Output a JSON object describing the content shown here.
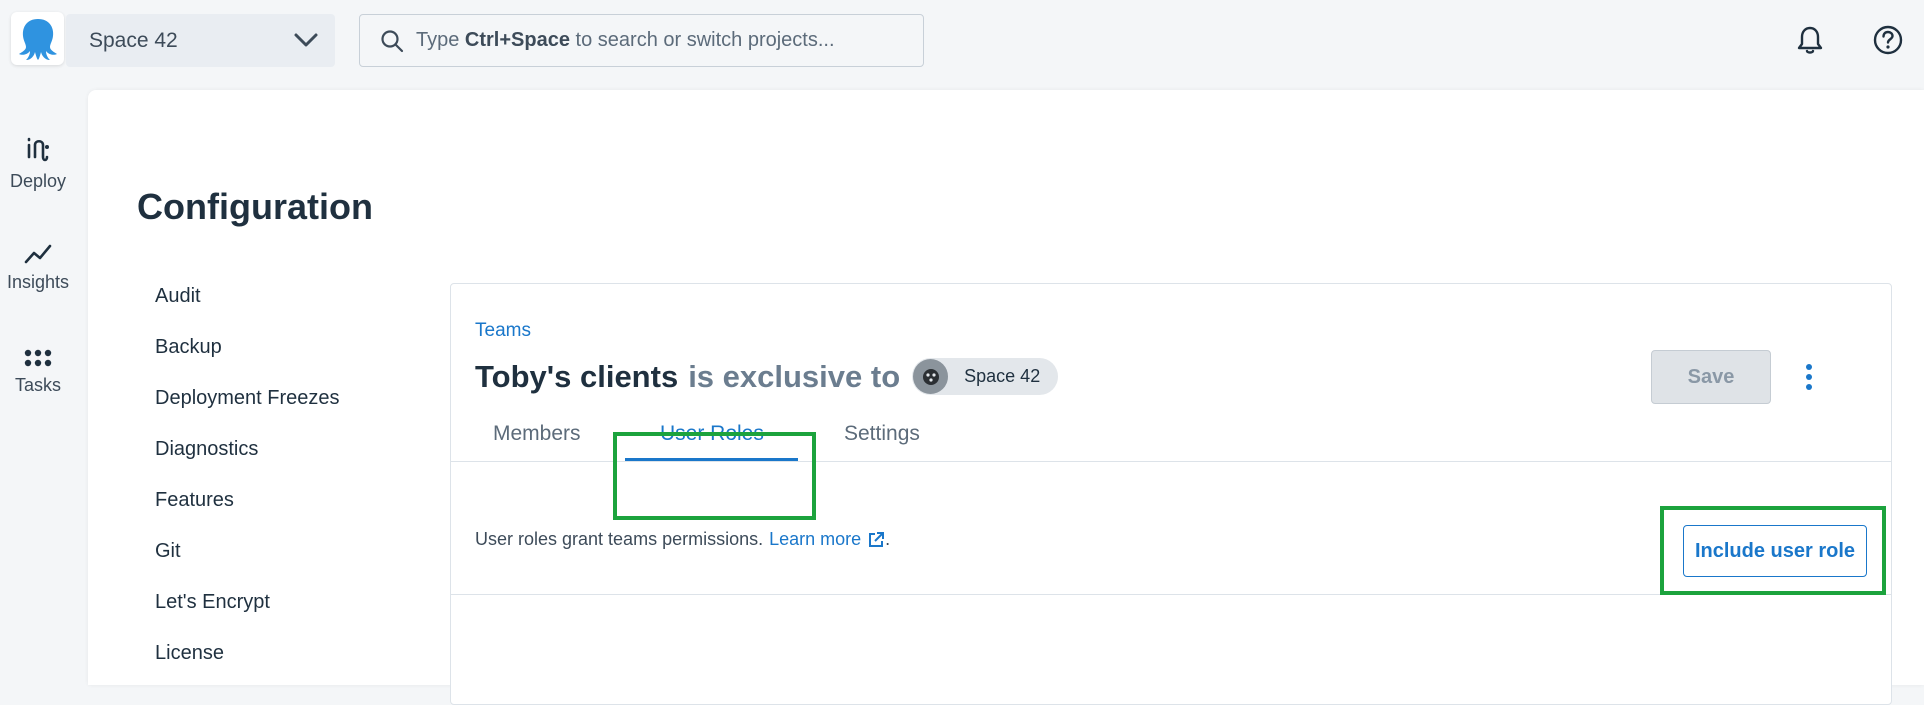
{
  "header": {
    "space_name": "Space 42",
    "search": {
      "prefix": "Type",
      "shortcut": "Ctrl+Space",
      "suffix": "to search or switch projects..."
    }
  },
  "left_nav": [
    {
      "label": "Deploy",
      "icon": "deploy-icon"
    },
    {
      "label": "Insights",
      "icon": "insights-icon"
    },
    {
      "label": "Tasks",
      "icon": "tasks-icon"
    }
  ],
  "page": {
    "title": "Configuration",
    "config_menu": [
      "Audit",
      "Backup",
      "Deployment Freezes",
      "Diagnostics",
      "Features",
      "Git",
      "Let's Encrypt",
      "License"
    ]
  },
  "team": {
    "breadcrumb": "Teams",
    "name": "Toby's clients",
    "exclusive_text": "is exclusive to",
    "space_chip": "Space 42",
    "save_label": "Save",
    "tabs": [
      {
        "label": "Members",
        "active": false
      },
      {
        "label": "User Roles",
        "active": true
      },
      {
        "label": "Settings",
        "active": false
      }
    ],
    "description": "User roles grant teams permissions.",
    "learn_more": "Learn more",
    "period": ".",
    "include_button": "Include user role"
  },
  "colors": {
    "accent": "#1a77ca",
    "highlight": "#1ca33d",
    "logo": "#2f93e0"
  }
}
